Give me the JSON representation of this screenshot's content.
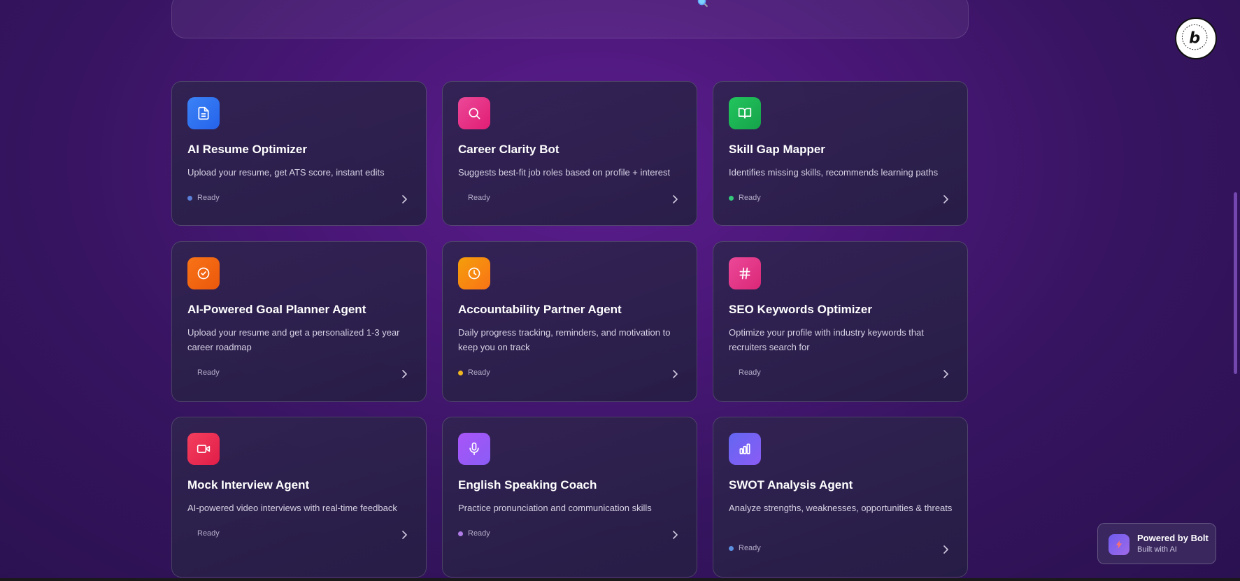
{
  "search": {
    "icon": "search-icon"
  },
  "cards": [
    {
      "title": "AI Resume Optimizer",
      "desc": "Upload your resume, get ATS score, instant edits",
      "status": "Ready",
      "icon": "document-icon",
      "color_from": "#3b82f6",
      "color_to": "#2563eb",
      "dot": "#5b7fd6"
    },
    {
      "title": "Career Clarity Bot",
      "desc": "Suggests best-fit job roles based on profile + interest",
      "status": "Ready",
      "icon": "search-icon",
      "color_from": "#ec4899",
      "color_to": "#e11d74",
      "dot": ""
    },
    {
      "title": "Skill Gap Mapper",
      "desc": "Identifies missing skills, recommends learning paths",
      "status": "Ready",
      "icon": "book-icon",
      "color_from": "#22c55e",
      "color_to": "#16a34a",
      "dot": "#34c77b"
    },
    {
      "title": "AI-Powered Goal Planner Agent",
      "desc": "Upload your resume and get a personalized 1-3 year career roadmap",
      "status": "Ready",
      "icon": "badge-check-icon",
      "color_from": "#f97316",
      "color_to": "#ea580c",
      "dot": ""
    },
    {
      "title": "Accountability Partner Agent",
      "desc": "Daily progress tracking, reminders, and motivation to keep you on track",
      "status": "Ready",
      "icon": "clock-icon",
      "color_from": "#f59e0b",
      "color_to": "#f97316",
      "dot": "#f2b71f"
    },
    {
      "title": "SEO Keywords Optimizer",
      "desc": "Optimize your profile with industry keywords that recruiters search for",
      "status": "Ready",
      "icon": "hash-icon",
      "color_from": "#ec4899",
      "color_to": "#db2777",
      "dot": ""
    },
    {
      "title": "Mock Interview Agent",
      "desc": "AI-powered video interviews with real-time feedback",
      "status": "Ready",
      "icon": "video-icon",
      "color_from": "#f43f5e",
      "color_to": "#e11d48",
      "dot": ""
    },
    {
      "title": "English Speaking Coach",
      "desc": "Practice pronunciation and communication skills",
      "status": "Ready",
      "icon": "mic-icon",
      "color_from": "#a855f7",
      "color_to": "#8b5cf6",
      "dot": "#b07ce8"
    },
    {
      "title": "SWOT Analysis Agent",
      "desc": "Analyze strengths, weaknesses, opportunities & threats",
      "status": "Ready",
      "icon": "bar-chart-icon",
      "color_from": "#6366f1",
      "color_to": "#8b5cf6",
      "dot": "#5b8fe0"
    }
  ],
  "bolt": {
    "title": "Powered by Bolt",
    "subtitle": "Built with AI",
    "badge_icon": "bolt-logo-icon"
  }
}
